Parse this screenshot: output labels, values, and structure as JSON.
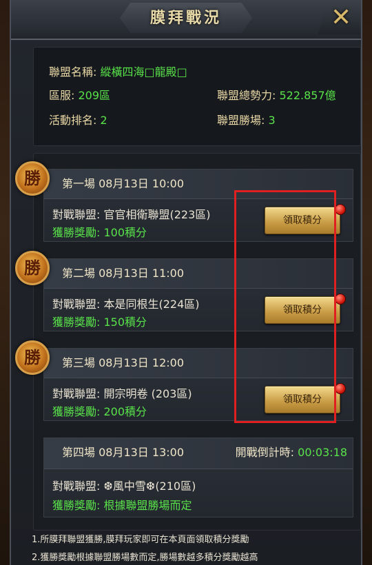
{
  "title": "膜拜戰況",
  "close_icon": "close-icon",
  "alliance_info": {
    "name_label": "聯盟名稱:",
    "name_value": "縱橫四海□龍殿□",
    "server_label": "區服:",
    "server_value": "209區",
    "power_label": "聯盟總勢力:",
    "power_value": "522.857億",
    "rank_label": "活動排名:",
    "rank_value": "2",
    "wins_label": "聯盟勝場:",
    "wins_value": "3"
  },
  "matches": [
    {
      "badge": "勝",
      "header": "第一場 08月13日 10:00",
      "opponent_label": "對戰聯盟:",
      "opponent_value": "官官相衛聯盟(223區)",
      "reward_label": "獲勝獎勵:",
      "reward_value": "100積分",
      "button_label": "領取積分"
    },
    {
      "badge": "勝",
      "header": "第二場 08月13日 11:00",
      "opponent_label": "對戰聯盟:",
      "opponent_value": "本是同根生(224區)",
      "reward_label": "獲勝獎勵:",
      "reward_value": "150積分",
      "button_label": "領取積分"
    },
    {
      "badge": "勝",
      "header": "第三場 08月13日 12:00",
      "opponent_label": "對戰聯盟:",
      "opponent_value": "開宗明卷 (203區)",
      "reward_label": "獲勝獎勵:",
      "reward_value": "200積分",
      "button_label": "領取積分"
    },
    {
      "header": "第四場 08月13日 13:00",
      "countdown_label": "開戰倒計時:",
      "countdown_value": "00:03:18",
      "opponent_label": "對戰聯盟:",
      "opponent_value": "❆風中雪❆(210區)",
      "reward_label": "獲勝獎勵:",
      "reward_value": "根據聯盟勝場而定"
    }
  ],
  "notes": [
    "1.所膜拜聯盟獲勝,膜拜玩家即可在本頁面領取積分獎勵",
    "2.獲勝獎勵根據聯盟勝場數而定,勝場數越多積分獎勵越高"
  ],
  "colors": {
    "accent_green": "#59e34a",
    "label_gold": "#e9d8a6",
    "highlight_red": "#e02020",
    "button_gold": "#c79a44"
  }
}
